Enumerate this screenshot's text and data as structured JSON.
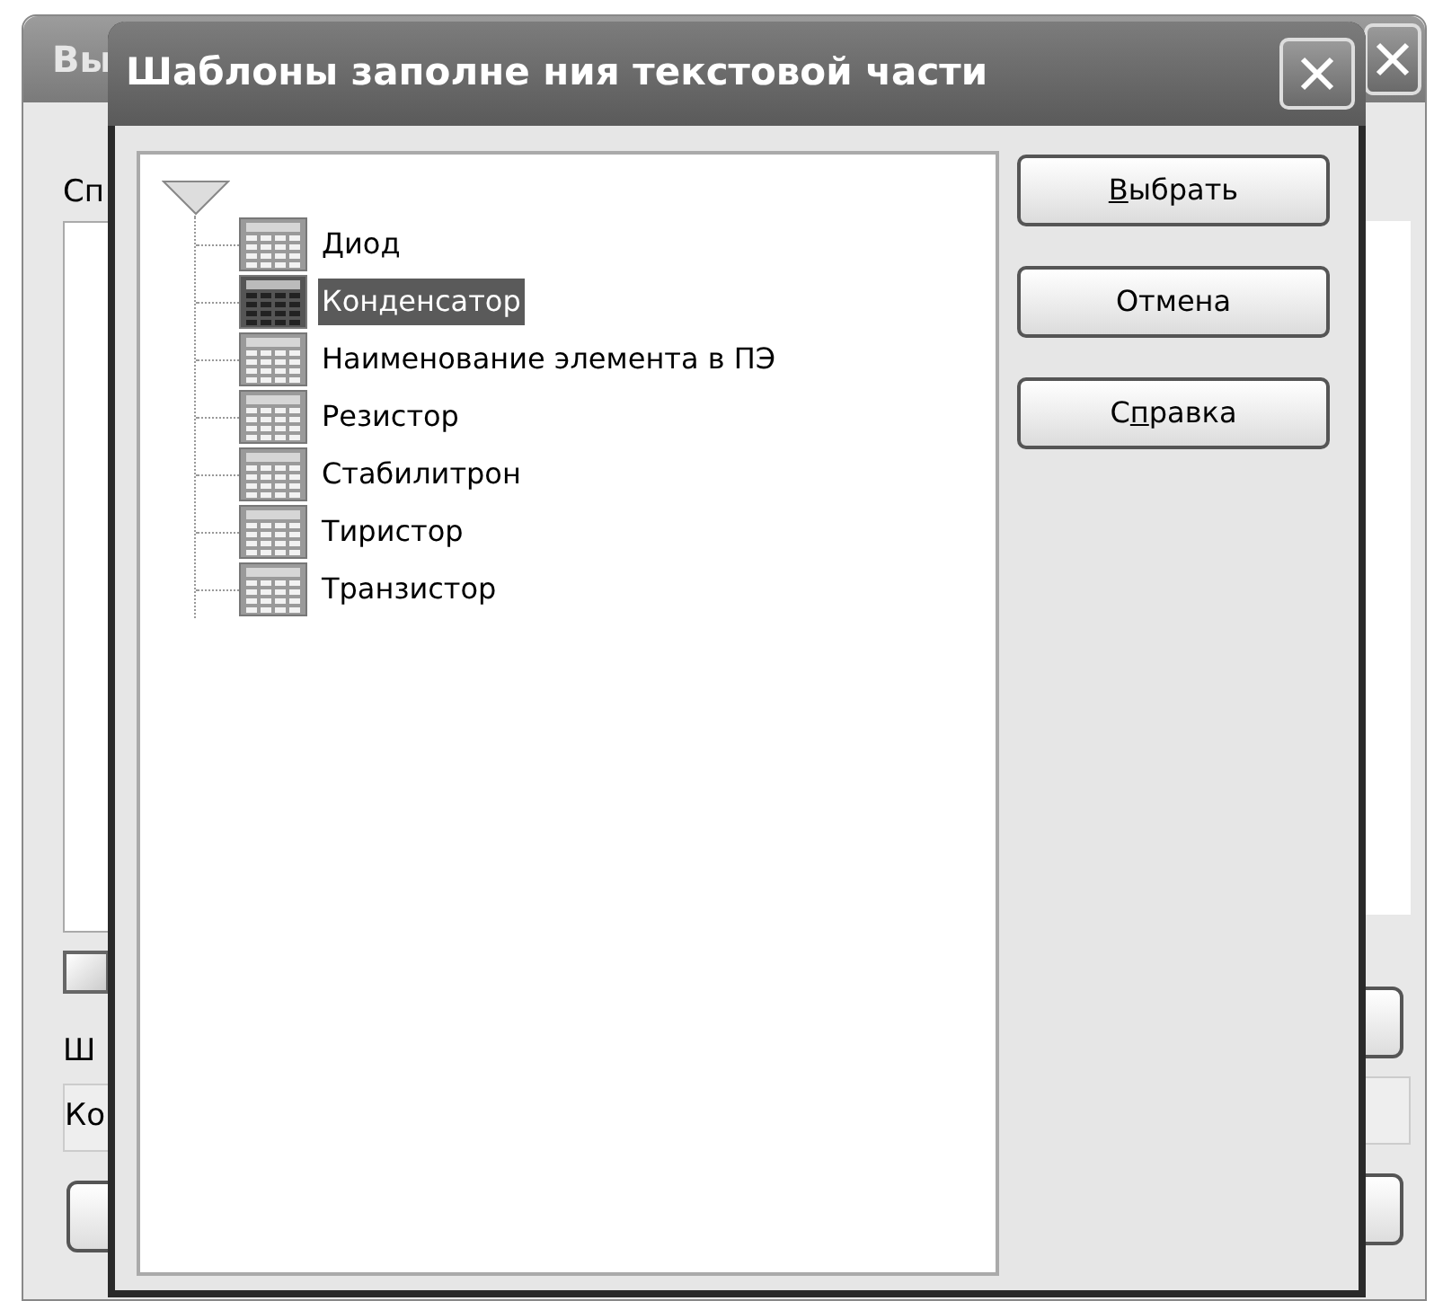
{
  "back_window": {
    "title": "Вы",
    "list_label": "Сп",
    "checkbox": {
      "checked": false
    },
    "template_label": "Ш",
    "template_value": "Ко"
  },
  "dialog": {
    "title": "Шаблоны заполне ния текстовой части",
    "tree": {
      "expanded": true,
      "children": [
        {
          "label": "Диод",
          "selected": false
        },
        {
          "label": "Конденсатор",
          "selected": true
        },
        {
          "label": "Наименование элемента в ПЭ",
          "selected": false
        },
        {
          "label": "Резистор",
          "selected": false
        },
        {
          "label": "Стабилитрон",
          "selected": false
        },
        {
          "label": "Тиристор",
          "selected": false
        },
        {
          "label": "Транзистор",
          "selected": false
        }
      ]
    },
    "buttons": [
      {
        "key": "В",
        "after": "ыбрать"
      },
      {
        "before": "Отмена"
      },
      {
        "before": "С",
        "key": "п",
        "after": "равка"
      }
    ]
  }
}
